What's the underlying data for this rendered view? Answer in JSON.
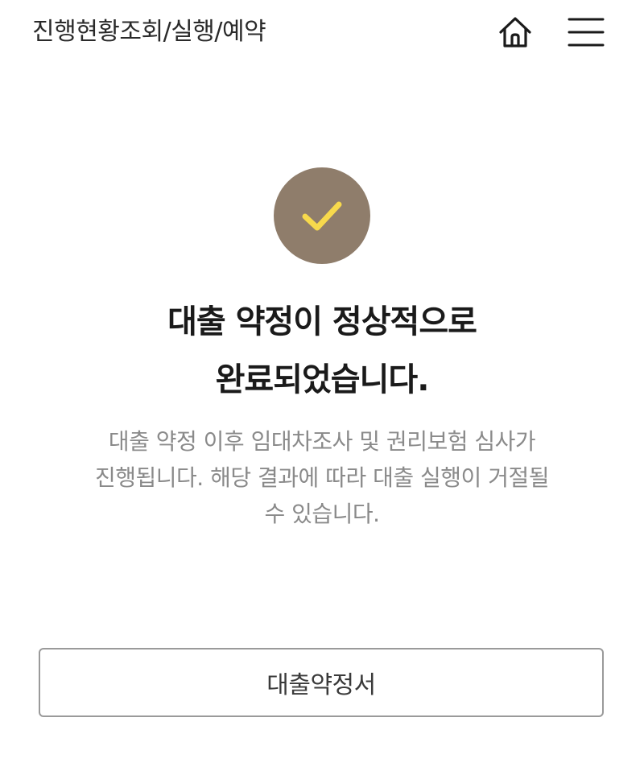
{
  "header": {
    "title": "진행현황조회/실행/예약",
    "home_icon": "home-icon",
    "menu_icon": "hamburger-menu-icon"
  },
  "status": {
    "icon": "check-icon",
    "circle_color": "#8f7d6b",
    "check_color": "#f7d94c"
  },
  "message": {
    "title_line1": "대출 약정이 정상적으로",
    "title_line2": "완료되었습니다.",
    "desc_line1": "대출 약정 이후 임대차조사 및 권리보험 심사가",
    "desc_line2": "진행됩니다. 해당 결과에 따라 대출 실행이 거절될",
    "desc_line3": "수 있습니다."
  },
  "actions": {
    "contract_button_label": "대출약정서"
  }
}
